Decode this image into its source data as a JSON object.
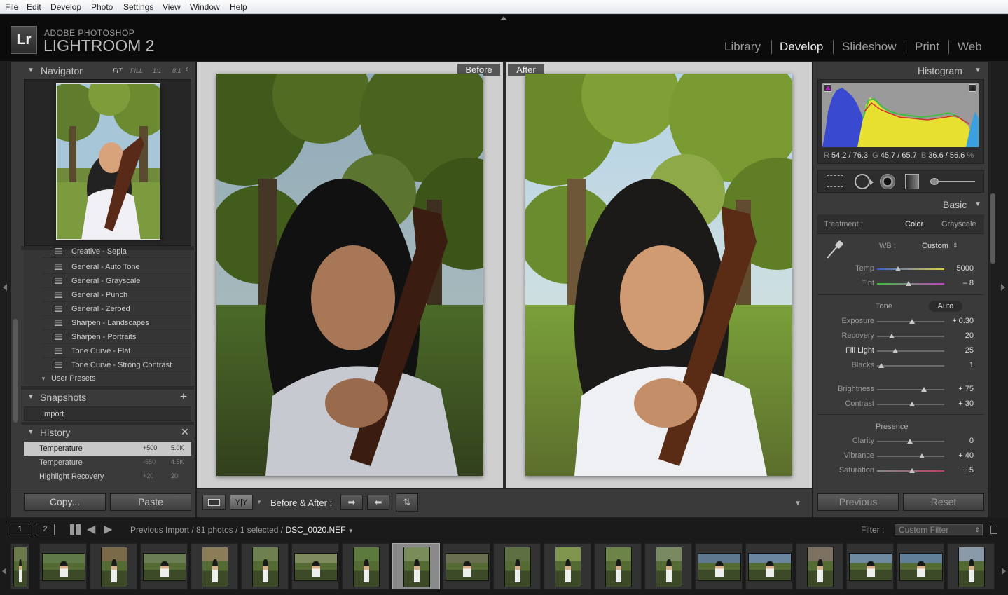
{
  "menubar": {
    "items": [
      "File",
      "Edit",
      "Develop",
      "Photo",
      "Settings",
      "View",
      "Window",
      "Help"
    ]
  },
  "identity": {
    "logo": "Lr",
    "brand_line1": "ADOBE PHOTOSHOP",
    "brand_line2": "LIGHTROOM 2"
  },
  "modules": [
    {
      "label": "Library",
      "active": false
    },
    {
      "label": "Develop",
      "active": true
    },
    {
      "label": "Slideshow",
      "active": false
    },
    {
      "label": "Print",
      "active": false
    },
    {
      "label": "Web",
      "active": false
    }
  ],
  "navigator": {
    "title": "Navigator",
    "zoom": [
      "FIT",
      "FILL",
      "1:1",
      "8:1"
    ]
  },
  "presets": {
    "items": [
      "Creative - Sepia",
      "General - Auto Tone",
      "General - Grayscale",
      "General - Punch",
      "General - Zeroed",
      "Sharpen - Landscapes",
      "Sharpen - Portraits",
      "Tone Curve - Flat",
      "Tone Curve - Strong Contrast"
    ],
    "user_folder": "User Presets"
  },
  "snapshots": {
    "title": "Snapshots",
    "items": [
      "Import"
    ]
  },
  "history": {
    "title": "History",
    "items": [
      {
        "label": "Temperature",
        "delta": "+500",
        "value": "5.0K",
        "selected": true
      },
      {
        "label": "Temperature",
        "delta": "-550",
        "value": "4.5K",
        "selected": false
      },
      {
        "label": "Highlight Recovery",
        "delta": "+20",
        "value": "20",
        "selected": false
      }
    ]
  },
  "left_buttons": {
    "copy": "Copy...",
    "paste": "Paste"
  },
  "compare": {
    "before": "Before",
    "after": "After"
  },
  "toolbar": {
    "yy": "Y|Y",
    "before_after_label": "Before & After :"
  },
  "histogram": {
    "title": "Histogram",
    "readout": {
      "r_label": "R",
      "r_value": "54.2 / 76.3",
      "g_label": "G",
      "g_value": "45.7 / 65.7",
      "b_label": "B",
      "b_value": "36.6 / 56.6",
      "unit": "%"
    }
  },
  "basic": {
    "title": "Basic",
    "treatment_label": "Treatment :",
    "treatment_color": "Color",
    "treatment_gray": "Grayscale",
    "wb_label": "WB :",
    "wb_value": "Custom",
    "tone_label": "Tone",
    "auto_label": "Auto",
    "presence_label": "Presence",
    "wb_sliders": [
      {
        "label": "Temp",
        "value": "5000",
        "pos": 0.31
      },
      {
        "label": "Tint",
        "value": "– 8",
        "pos": 0.47
      }
    ],
    "tone_sliders": [
      {
        "label": "Exposure",
        "value": "+ 0.30",
        "pos": 0.52
      },
      {
        "label": "Recovery",
        "value": "20",
        "pos": 0.22
      },
      {
        "label": "Fill Light",
        "value": "25",
        "pos": 0.27
      },
      {
        "label": "Blacks",
        "value": "1",
        "pos": 0.06
      }
    ],
    "tone_sliders2": [
      {
        "label": "Brightness",
        "value": "+ 75",
        "pos": 0.7
      },
      {
        "label": "Contrast",
        "value": "+ 30",
        "pos": 0.52
      }
    ],
    "presence_sliders": [
      {
        "label": "Clarity",
        "value": "0",
        "pos": 0.49
      },
      {
        "label": "Vibrance",
        "value": "+ 40",
        "pos": 0.67
      },
      {
        "label": "Saturation",
        "value": "+ 5",
        "pos": 0.52
      }
    ]
  },
  "right_buttons": {
    "previous": "Previous",
    "reset": "Reset"
  },
  "filmstrip": {
    "page1": "1",
    "page2": "2",
    "source": "Previous Import / 81 photos / 1 selected / ",
    "filename": "DSC_0020.NEF",
    "filter_label": "Filter :",
    "filter_value": "Custom Filter"
  },
  "colors": {
    "accent": "#8a8a8a",
    "histogram_blue": "#3a4ad0",
    "histogram_yellow": "#e8e030",
    "histogram_green": "#40c040",
    "histogram_red": "#d03030"
  }
}
